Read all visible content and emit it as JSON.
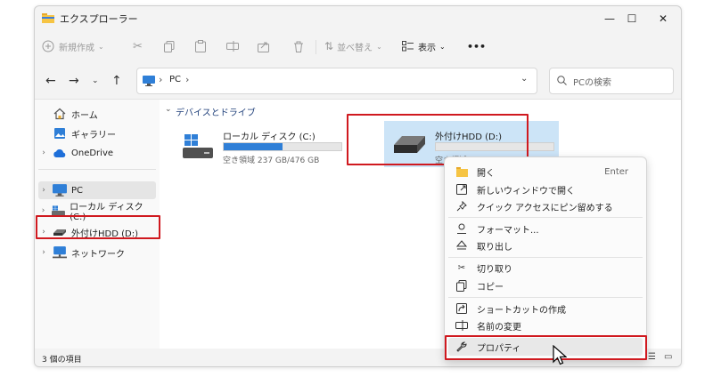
{
  "window": {
    "title": "エクスプローラー"
  },
  "window_controls": {
    "minimize": "—",
    "maximize": "☐",
    "close": "✕"
  },
  "toolbar": {
    "new_label": "新規作成",
    "sort_label": "並べ替え",
    "view_label": "表示",
    "more_label": "•••"
  },
  "address": {
    "path_segment": "PC",
    "separator": "›"
  },
  "search": {
    "placeholder": "PCの検索"
  },
  "sidebar": {
    "items": [
      {
        "label": "ホーム"
      },
      {
        "label": "ギャラリー"
      },
      {
        "label": "OneDrive"
      },
      {
        "label": "PC"
      },
      {
        "label": "ローカル ディスク (C:)"
      },
      {
        "label": "外付けHDD (D:)"
      },
      {
        "label": "ネットワーク"
      }
    ]
  },
  "content": {
    "group_label": "デバイスとドライブ",
    "drives": [
      {
        "name": "ローカル ディスク (C:)",
        "space": "空き領域 237 GB/476 GB",
        "used_fraction": 0.5
      },
      {
        "name": "外付けHDD (D:)",
        "space": "空き領域 931 GB/931 GB",
        "used_fraction": 0.0
      }
    ]
  },
  "context_menu": {
    "open": {
      "label": "開く",
      "shortcut": "Enter"
    },
    "open_new_window": "新しいウィンドウで開く",
    "pin_quick_access": "クイック アクセスにピン留めする",
    "format": "フォーマット...",
    "eject": "取り出し",
    "cut": "切り取り",
    "copy": "コピー",
    "create_shortcut": "ショートカットの作成",
    "rename": "名前の変更",
    "properties": "プロパティ"
  },
  "status": {
    "count": "3 個の項目"
  },
  "colors": {
    "accent": "#2f7fd7",
    "highlight": "#d0191f",
    "selection": "#cce4f7"
  }
}
